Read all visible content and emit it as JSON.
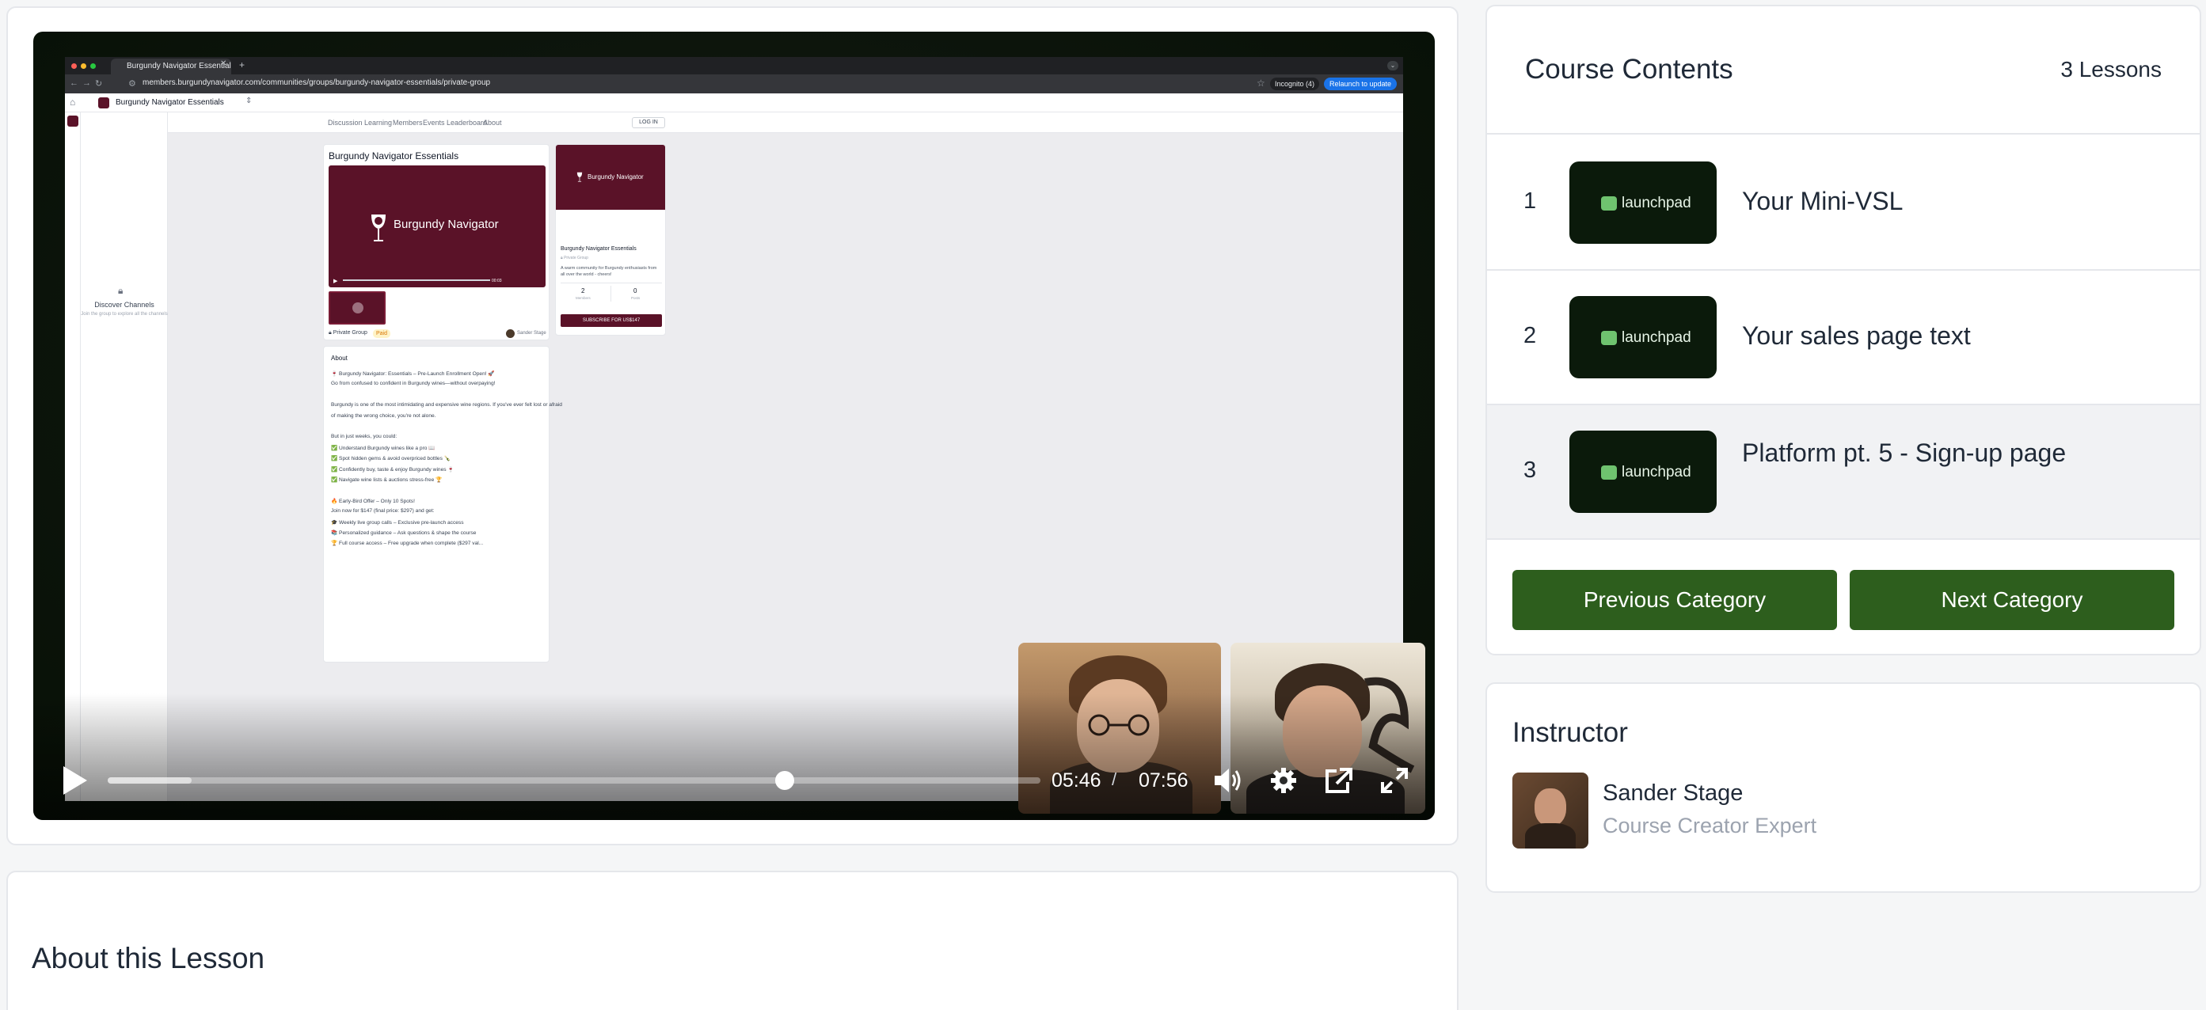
{
  "video": {
    "browser": {
      "tab_title": "Burgundy Navigator Essentials",
      "url": "members.burgundynavigator.com/communities/groups/burgundy-navigator-essentials/private-group",
      "incognito_label": "Incognito (4)",
      "relaunch_label": "Relaunch to update"
    },
    "app": {
      "name": "Burgundy Navigator Essentials",
      "discover_title": "Discover Channels",
      "discover_sub": "Join the group to explore all the channels",
      "nav": [
        "Discussion",
        "Learning",
        "Members",
        "Events",
        "Leaderboard",
        "About"
      ],
      "login_label": "LOG IN",
      "group_title": "Burgundy Navigator Essentials",
      "brand_title": "Burgundy Navigator",
      "player_time": "00:03",
      "tag_private": "Private Group",
      "tag_paid": "Paid",
      "owner": "Sander Stage",
      "about_heading": "About",
      "about_lines": [
        "🍷 Burgundy Navigator: Essentials – Pre-Launch Enrollment Open! 🚀",
        "Go from confused to confident in Burgundy wines—without overpaying!",
        "",
        "Burgundy is one of the most intimidating and expensive wine regions. If you've ever felt lost or afraid",
        "of making the wrong choice, you're not alone.",
        "",
        "But in just weeks, you could:",
        "✅ Understand Burgundy wines like a pro 📖",
        "✅ Spot hidden gems & avoid overpriced bottles 🍾",
        "✅ Confidently buy, taste & enjoy Burgundy wines 🍷",
        "✅ Navigate wine lists & auctions stress-free 🏆",
        "",
        "🔥 Early-Bird Offer – Only 10 Spots!",
        "Join now for $147 (final price: $297) and get:",
        "🎓 Weekly live group calls – Exclusive pre-launch access",
        "📚 Personalized guidance – Ask questions & shape the course",
        "🏆 Full course access – Free upgrade when complete ($297 val..."
      ],
      "community_name": "Burgundy Navigator Essentials",
      "community_private": "Private Group",
      "community_desc": "A warm community for Burgundy enthusiasts from all over the world - cheers!",
      "members_count": "2",
      "members_label": "Members",
      "posts_count": "0",
      "posts_label": "Posts",
      "subscribe_label": "SUBSCRIBE FOR US$147"
    },
    "controls": {
      "current_time": "05:46",
      "separator": "/",
      "duration": "07:56",
      "progress": 0.726,
      "buffered": 0.09
    }
  },
  "lesson_section": {
    "title": "About this Lesson"
  },
  "course": {
    "title": "Course Contents",
    "count_label": "3 Lessons",
    "thumb_brand": "launchpad",
    "lessons": [
      {
        "num": "1",
        "title": "Your Mini-VSL"
      },
      {
        "num": "2",
        "title": "Your sales page text"
      },
      {
        "num": "3",
        "title": "Platform pt. 5 - Sign-up page"
      }
    ],
    "prev_label": "Previous Category",
    "next_label": "Next Category",
    "button_color": "#2d5e1d"
  },
  "instructor": {
    "title": "Instructor",
    "name": "Sander Stage",
    "role": "Course Creator Expert"
  }
}
